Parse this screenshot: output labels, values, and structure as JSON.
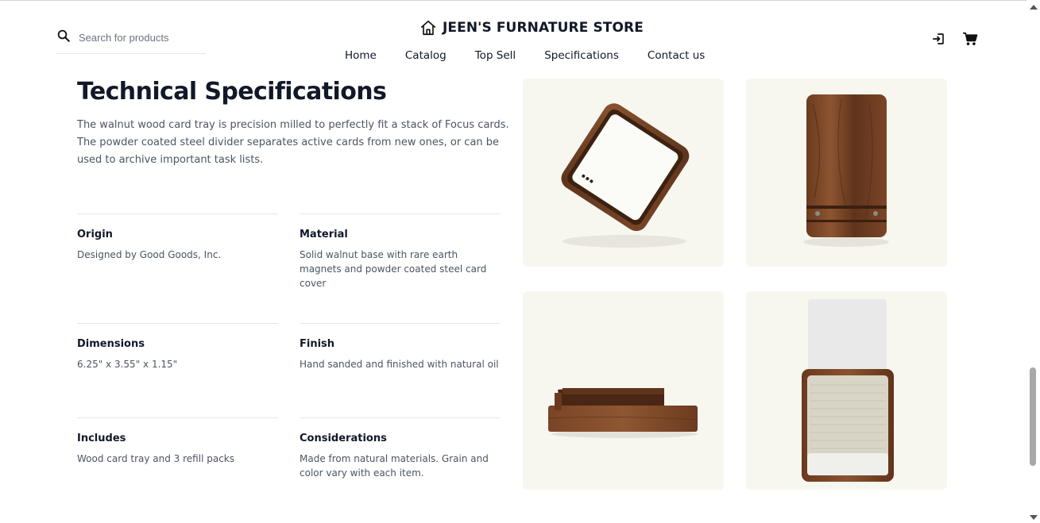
{
  "header": {
    "search_placeholder": "Search for products",
    "store_name": "JEEN'S FURNATURE STORE",
    "nav": [
      "Home",
      "Catalog",
      "Top Sell",
      "Specifications",
      "Contact us"
    ],
    "icons": [
      "login-icon",
      "cart-icon"
    ]
  },
  "main": {
    "title": "Technical Specifications",
    "description": "The walnut wood card tray is precision milled to perfectly fit a stack of Focus cards. The powder coated steel divider separates active cards from new ones, or can be used to archive important task lists.",
    "specs": [
      {
        "term": "Origin",
        "value": "Designed by Good Goods, Inc."
      },
      {
        "term": "Material",
        "value": "Solid walnut base with rare earth magnets and powder coated steel card cover"
      },
      {
        "term": "Dimensions",
        "value": "6.25\" x 3.55\" x 1.15\""
      },
      {
        "term": "Finish",
        "value": "Hand sanded and finished with natural oil"
      },
      {
        "term": "Includes",
        "value": "Wood card tray and 3 refill packs"
      },
      {
        "term": "Considerations",
        "value": "Made from natural materials. Grain and color vary with each item."
      }
    ],
    "images": [
      "card-tray-top-angle",
      "card-tray-closed-top",
      "card-tray-side-angle",
      "card-tray-front-with-cards"
    ]
  },
  "colors": {
    "text_primary": "#111827",
    "text_secondary": "#4b5563",
    "divider": "#e5e7eb",
    "image_background": "#f7f7f0",
    "walnut": "#6b3e22"
  }
}
